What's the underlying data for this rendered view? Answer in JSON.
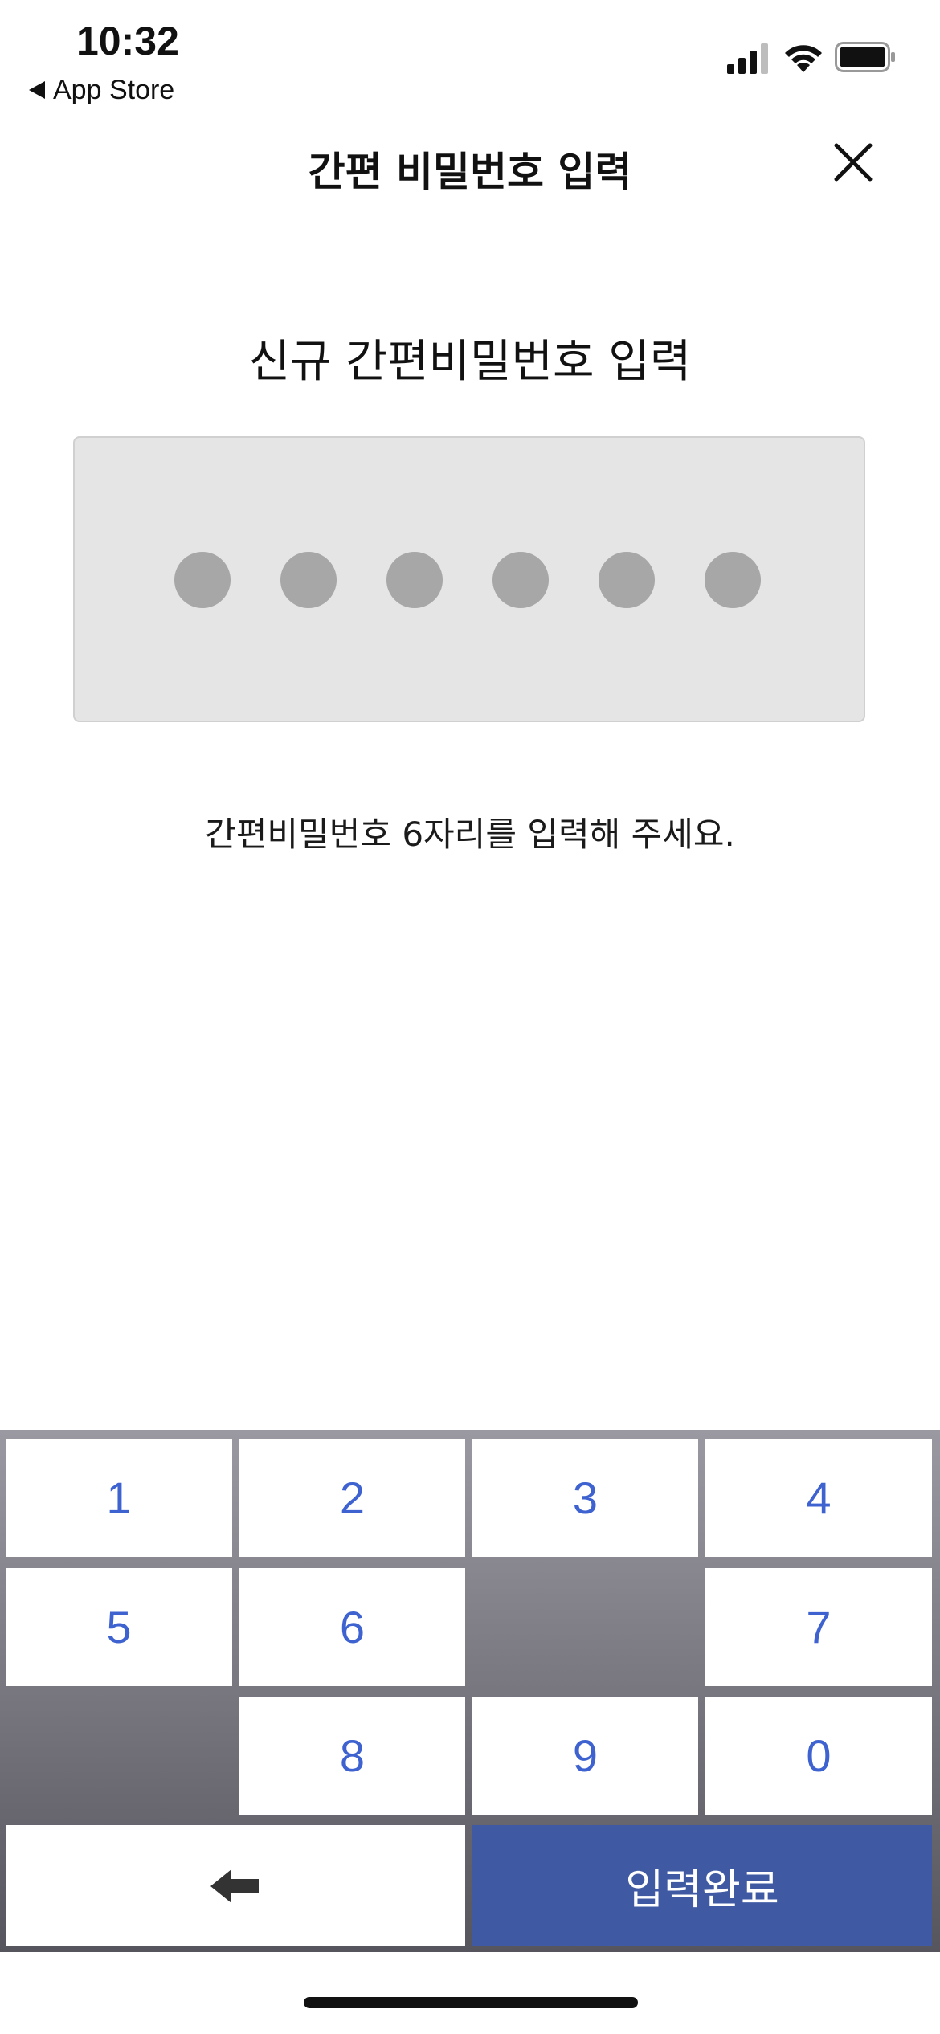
{
  "status_bar": {
    "time": "10:32",
    "back_label": "App Store",
    "icons": [
      "cellular-signal-icon",
      "wifi-icon",
      "battery-icon"
    ]
  },
  "nav": {
    "title": "간편 비밀번호 입력",
    "close_icon": "close-icon"
  },
  "main": {
    "section_title": "신규 간편비밀번호 입력",
    "pin_length": 6,
    "pin_entered": 0,
    "hint": "간편비밀번호 6자리를 입력해 주세요."
  },
  "keypad": {
    "row1": [
      "1",
      "2",
      "3",
      "4"
    ],
    "row2": [
      "5",
      "6",
      "7"
    ],
    "row3": [
      "8",
      "9",
      "0"
    ],
    "backspace_icon": "backspace-arrow-icon",
    "confirm_label": "입력완료"
  },
  "colors": {
    "key_text": "#3e63d0",
    "confirm_bg": "#3f5aa3",
    "pin_box_bg": "#e5e5e5",
    "pin_dot": "#a7a7a7"
  }
}
